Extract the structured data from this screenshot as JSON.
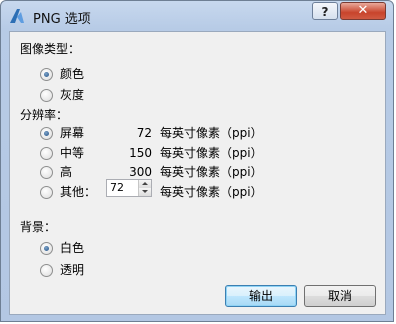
{
  "window": {
    "title": "PNG 选项",
    "help_label": "?",
    "close_label": "✕"
  },
  "image_type": {
    "label": "图像类型：",
    "options": [
      {
        "label": "颜色",
        "selected": true
      },
      {
        "label": "灰度",
        "selected": false
      }
    ]
  },
  "resolution": {
    "label": "分辨率：",
    "unit": "每英寸像素（ppi）",
    "options": [
      {
        "label": "屏幕",
        "value": "72",
        "selected": true
      },
      {
        "label": "中等",
        "value": "150",
        "selected": false
      },
      {
        "label": "高",
        "value": "300",
        "selected": false
      },
      {
        "label": "其他：",
        "value": "72",
        "selected": false
      }
    ]
  },
  "background": {
    "label": "背景：",
    "options": [
      {
        "label": "白色",
        "selected": true
      },
      {
        "label": "透明",
        "selected": false
      }
    ]
  },
  "buttons": {
    "ok": "输出",
    "cancel": "取消"
  },
  "colors": {
    "titlebar": "#b9cde8",
    "close_button": "#c8442c",
    "dialog_body": "#f0f0f0",
    "radio_dot": "#1f4f86"
  }
}
